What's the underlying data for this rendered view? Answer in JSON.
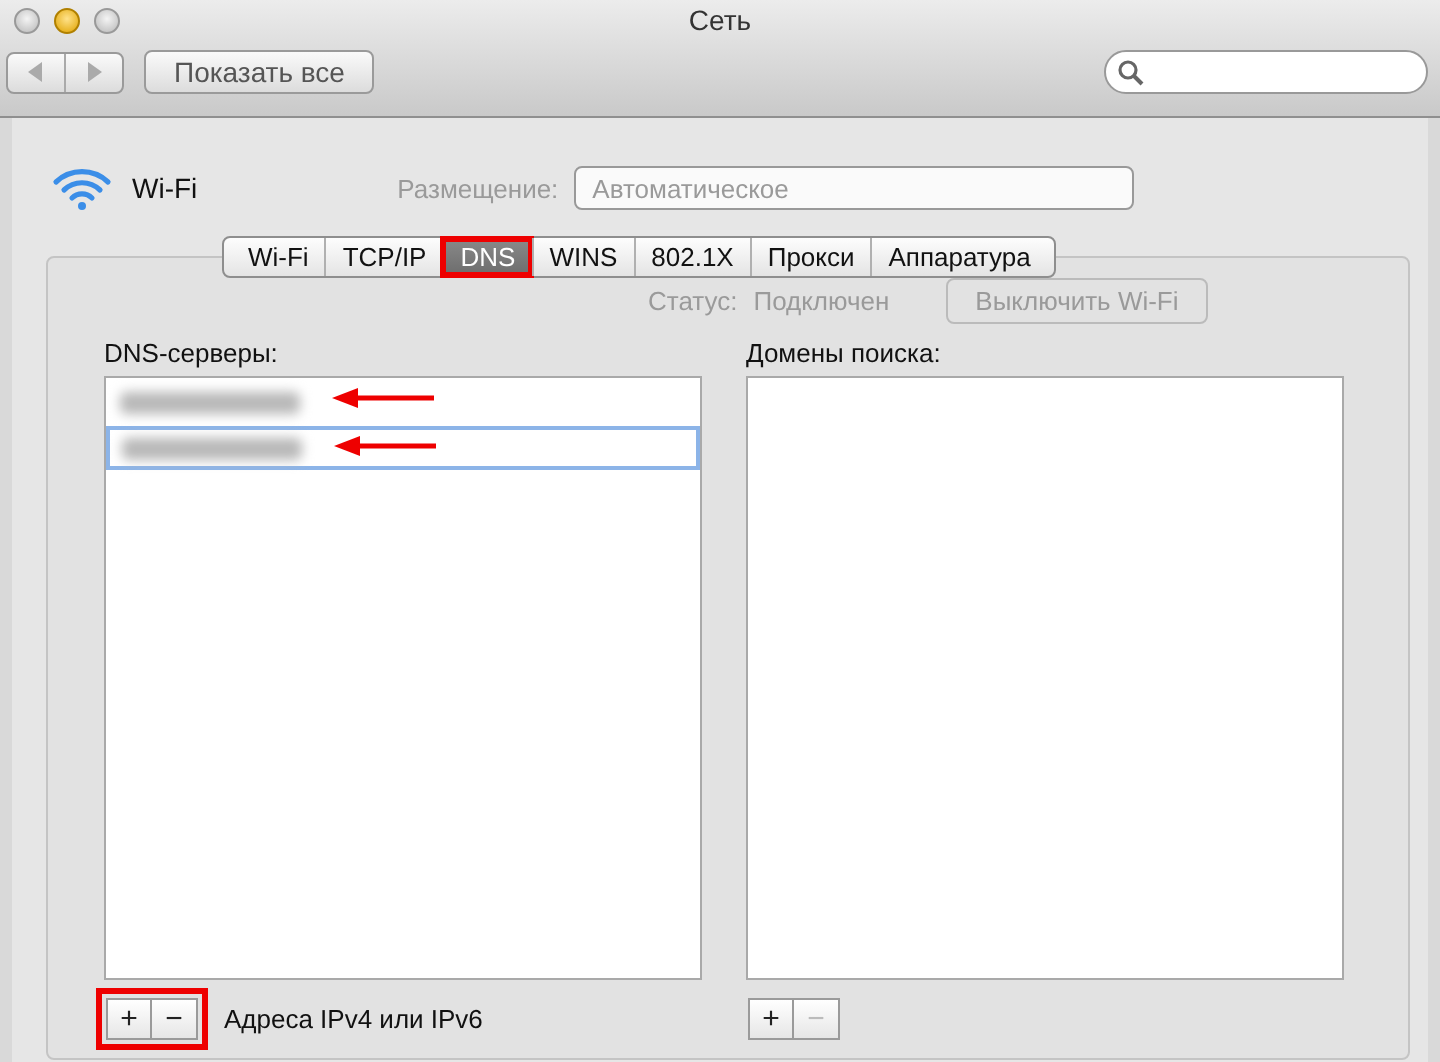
{
  "window": {
    "title": "Сеть"
  },
  "toolbar": {
    "show_all": "Показать все"
  },
  "service": {
    "name": "Wi-Fi"
  },
  "background": {
    "location_label": "Размещение:",
    "location_value": "Автоматическое",
    "status_label": "Статус:",
    "status_value": "Подключен",
    "turn_off_button": "Выключить Wi-Fi"
  },
  "tabs": [
    {
      "label": "Wi-Fi",
      "selected": false,
      "highlighted": false
    },
    {
      "label": "TCP/IP",
      "selected": false,
      "highlighted": false
    },
    {
      "label": "DNS",
      "selected": true,
      "highlighted": true
    },
    {
      "label": "WINS",
      "selected": false,
      "highlighted": false
    },
    {
      "label": "802.1X",
      "selected": false,
      "highlighted": false
    },
    {
      "label": "Прокси",
      "selected": false,
      "highlighted": false
    },
    {
      "label": "Аппаратура",
      "selected": false,
      "highlighted": false
    }
  ],
  "dns_servers": {
    "label": "DNS-серверы:",
    "entries": [
      {
        "editing": false,
        "marked": true
      },
      {
        "editing": true,
        "marked": true
      }
    ],
    "buttons_highlighted": true,
    "buttons": [
      {
        "label": "+",
        "disabled": false
      },
      {
        "label": "−",
        "disabled": false
      }
    ],
    "hint": "Адреса IPv4 или IPv6"
  },
  "search_domains": {
    "label": "Домены поиска:",
    "buttons": [
      {
        "label": "+",
        "disabled": false
      },
      {
        "label": "−",
        "disabled": true
      }
    ]
  }
}
